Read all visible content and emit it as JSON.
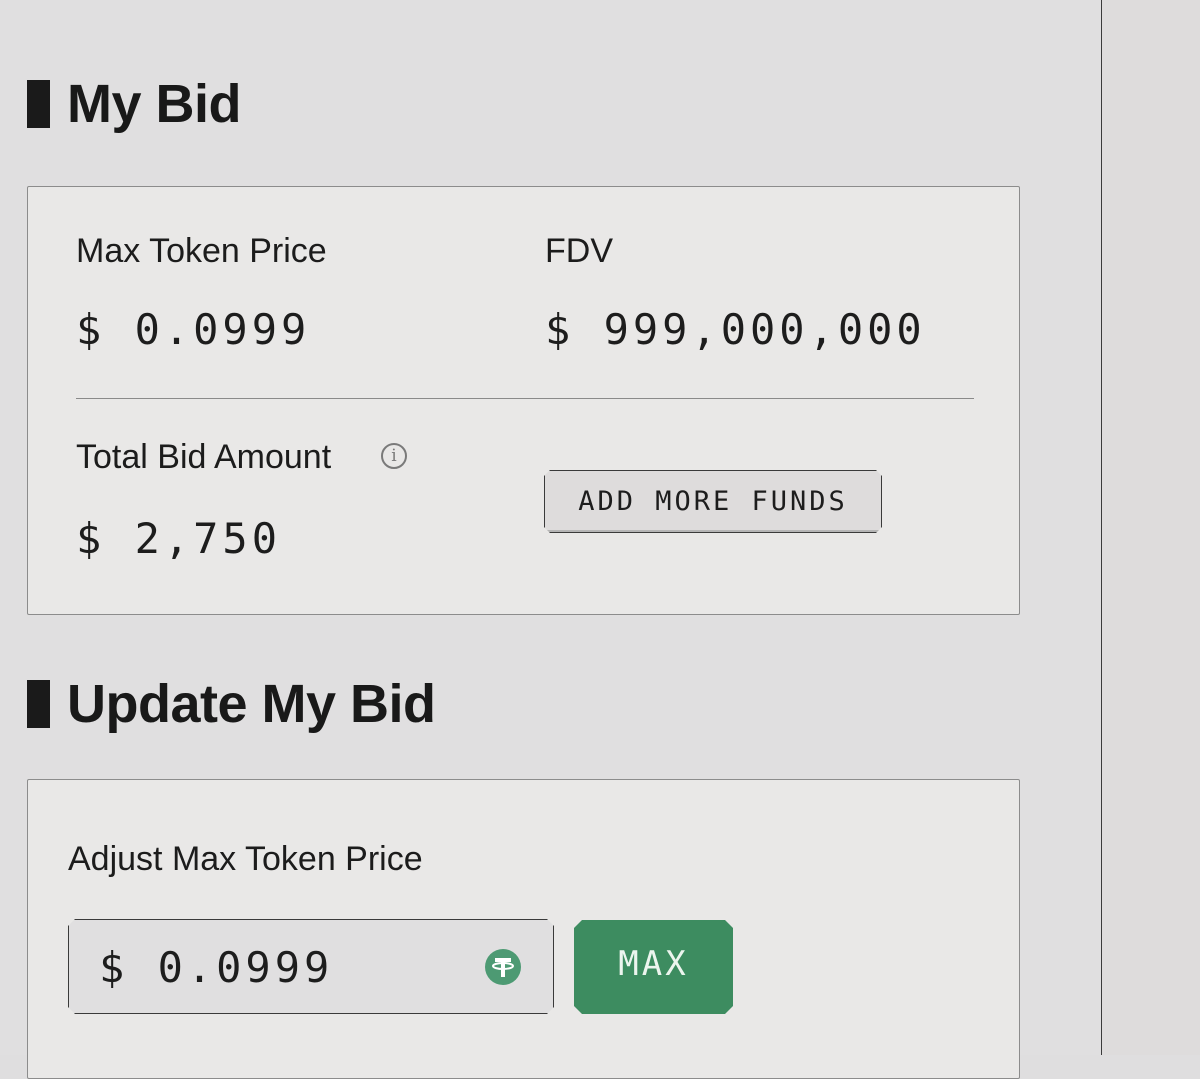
{
  "my_bid": {
    "heading": "My Bid",
    "max_token_price_label": "Max Token Price",
    "max_token_price_value": "$ 0.0999",
    "fdv_label": "FDV",
    "fdv_value": "$ 999,000,000",
    "total_bid_label": "Total Bid Amount",
    "total_bid_value": "$ 2,750",
    "info_icon": "info-icon",
    "add_funds_label": "ADD MORE FUNDS"
  },
  "update_bid": {
    "heading": "Update My Bid",
    "adjust_label": "Adjust Max Token Price",
    "price_input_value": "$ 0.0999",
    "currency_icon": "tether-icon",
    "max_label": "MAX"
  },
  "colors": {
    "accent_green": "#3d8c60",
    "panel_bg": "#e9e8e7",
    "page_bg": "#e0dfe0"
  }
}
